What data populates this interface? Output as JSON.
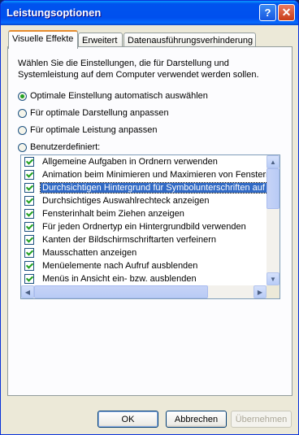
{
  "window": {
    "title": "Leistungsoptionen",
    "help_glyph": "?",
    "close_glyph": "✕"
  },
  "tabs": [
    {
      "label": "Visuelle Effekte",
      "active": true
    },
    {
      "label": "Erweitert",
      "active": false
    },
    {
      "label": "Datenausführungsverhinderung",
      "active": false
    }
  ],
  "description": "Wählen Sie die Einstellungen, die für Darstellung und Systemleistung auf dem Computer verwendet werden sollen.",
  "radios": [
    {
      "label": "Optimale Einstellung automatisch auswählen",
      "selected": true
    },
    {
      "label": "Für optimale Darstellung anpassen",
      "selected": false
    },
    {
      "label": "Für optimale Leistung anpassen",
      "selected": false
    },
    {
      "label": "Benutzerdefiniert:",
      "selected": false
    }
  ],
  "effects": [
    {
      "label": "Allgemeine Aufgaben in Ordnern verwenden",
      "checked": true
    },
    {
      "label": "Animation beim Minimieren und Maximieren von Fenstern",
      "checked": true
    },
    {
      "label": "Durchsichtigen Hintergrund für Symbolunterschriften auf d",
      "checked": true,
      "selected": true
    },
    {
      "label": "Durchsichtiges Auswahlrechteck anzeigen",
      "checked": true
    },
    {
      "label": "Fensterinhalt beim Ziehen anzeigen",
      "checked": true
    },
    {
      "label": "Für jeden Ordnertyp ein Hintergrundbild verwenden",
      "checked": true
    },
    {
      "label": "Kanten der Bildschirmschriftarten verfeinern",
      "checked": true
    },
    {
      "label": "Mausschatten anzeigen",
      "checked": true
    },
    {
      "label": "Menüelemente nach Aufruf ausblenden",
      "checked": true
    },
    {
      "label": "Menüs in Ansicht ein- bzw. ausblenden",
      "checked": true
    }
  ],
  "scrollbar_glyphs": {
    "up": "▲",
    "down": "▼",
    "left": "◀",
    "right": "▶"
  },
  "buttons": {
    "ok": "OK",
    "cancel": "Abbrechen",
    "apply": "Übernehmen"
  },
  "colors": {
    "titlebar": "#0053ee",
    "selection": "#316ac5",
    "check": "#21a121",
    "tab_highlight": "#e68b2c"
  }
}
